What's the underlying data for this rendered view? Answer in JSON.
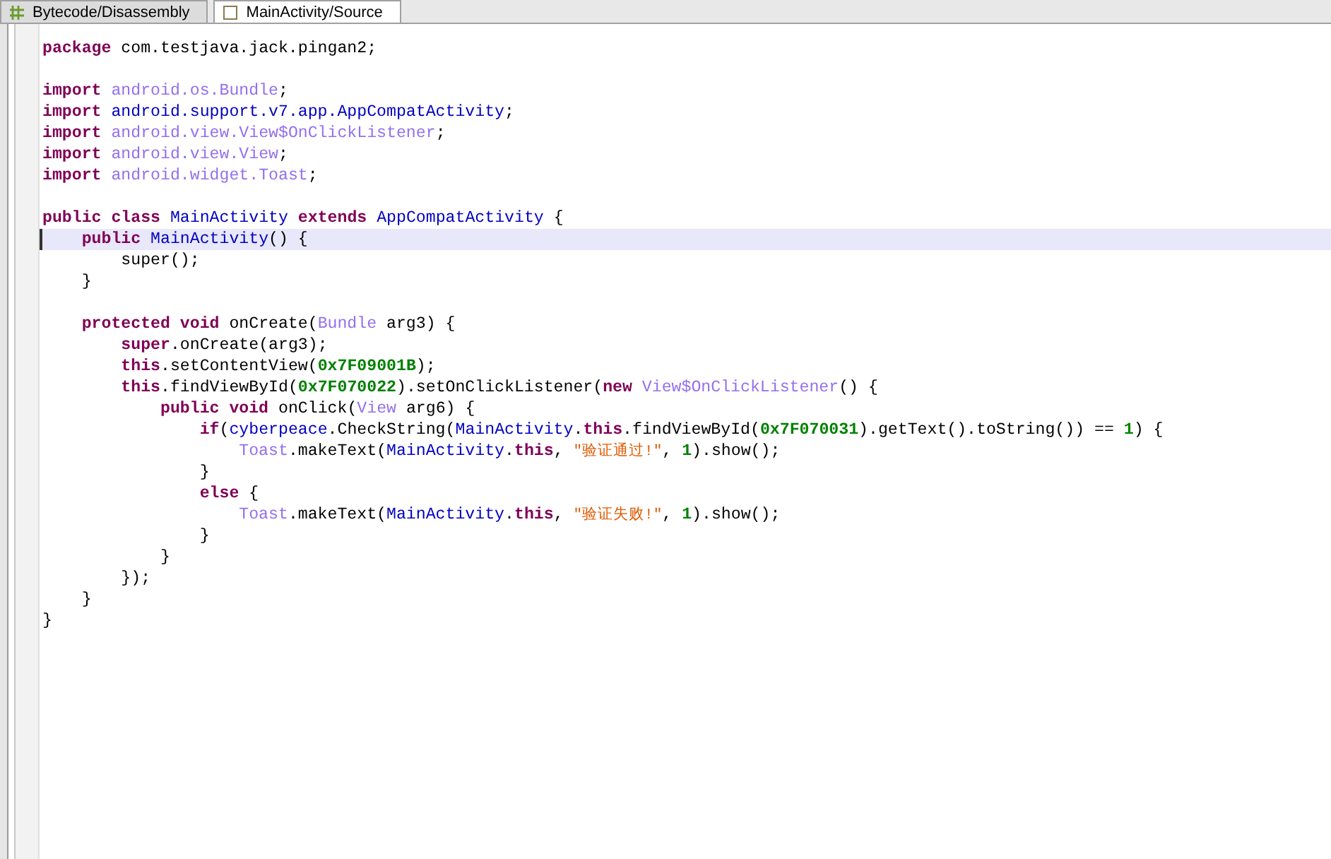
{
  "tabs": [
    {
      "label": "Bytecode/Disassembly",
      "selected": false,
      "kind": "bytecode"
    },
    {
      "label": "MainActivity/Source",
      "selected": true,
      "kind": "source"
    }
  ],
  "lines": [
    {
      "kind": "code",
      "selected": false,
      "tokens": [
        {
          "kind": "kw",
          "text": "package"
        },
        {
          "kind": "plain",
          "text": " com.testjava.jack.pingan2;"
        }
      ]
    },
    {
      "kind": "blank",
      "selected": false
    },
    {
      "kind": "code",
      "selected": false,
      "tokens": [
        {
          "kind": "kw",
          "text": "import"
        },
        {
          "kind": "type",
          "text": " android.os.Bundle"
        },
        {
          "kind": "plain",
          "text": ";"
        }
      ]
    },
    {
      "kind": "code",
      "selected": false,
      "tokens": [
        {
          "kind": "kw",
          "text": "import"
        },
        {
          "kind": "cls",
          "text": " android.support.v7.app.AppCompatActivity"
        },
        {
          "kind": "plain",
          "text": ";"
        }
      ]
    },
    {
      "kind": "code",
      "selected": false,
      "tokens": [
        {
          "kind": "kw",
          "text": "import"
        },
        {
          "kind": "type",
          "text": " android.view.View$OnClickListener"
        },
        {
          "kind": "plain",
          "text": ";"
        }
      ]
    },
    {
      "kind": "code",
      "selected": false,
      "tokens": [
        {
          "kind": "kw",
          "text": "import"
        },
        {
          "kind": "type",
          "text": " android.view.View"
        },
        {
          "kind": "plain",
          "text": ";"
        }
      ]
    },
    {
      "kind": "code",
      "selected": false,
      "tokens": [
        {
          "kind": "kw",
          "text": "import"
        },
        {
          "kind": "type",
          "text": " android.widget.Toast"
        },
        {
          "kind": "plain",
          "text": ";"
        }
      ]
    },
    {
      "kind": "blank",
      "selected": false
    },
    {
      "kind": "code",
      "selected": false,
      "tokens": [
        {
          "kind": "kw",
          "text": "public class"
        },
        {
          "kind": "cls",
          "text": " MainActivity"
        },
        {
          "kind": "kw",
          "text": " extends"
        },
        {
          "kind": "cls",
          "text": " AppCompatActivity"
        },
        {
          "kind": "plain",
          "text": " {"
        }
      ]
    },
    {
      "kind": "code",
      "selected": true,
      "tokens": [
        {
          "kind": "kw",
          "text": "    public"
        },
        {
          "kind": "cls",
          "text": " MainActivity"
        },
        {
          "kind": "plain",
          "text": "() {"
        }
      ]
    },
    {
      "kind": "code",
      "selected": false,
      "tokens": [
        {
          "kind": "plain",
          "text": "        super();"
        }
      ]
    },
    {
      "kind": "code",
      "selected": false,
      "tokens": [
        {
          "kind": "plain",
          "text": "    }"
        }
      ]
    },
    {
      "kind": "blank",
      "selected": false
    },
    {
      "kind": "code",
      "selected": false,
      "tokens": [
        {
          "kind": "kw",
          "text": "    protected void"
        },
        {
          "kind": "plain",
          "text": " onCreate("
        },
        {
          "kind": "type",
          "text": "Bundle"
        },
        {
          "kind": "plain",
          "text": " arg3) {"
        }
      ]
    },
    {
      "kind": "code",
      "selected": false,
      "tokens": [
        {
          "kind": "kw",
          "text": "        super"
        },
        {
          "kind": "plain",
          "text": ".onCreate(arg3);"
        }
      ]
    },
    {
      "kind": "code",
      "selected": false,
      "tokens": [
        {
          "kind": "kw",
          "text": "        this"
        },
        {
          "kind": "plain",
          "text": ".setContentView("
        },
        {
          "kind": "num",
          "text": "0x7F09001B"
        },
        {
          "kind": "plain",
          "text": ");"
        }
      ]
    },
    {
      "kind": "code",
      "selected": false,
      "tokens": [
        {
          "kind": "kw",
          "text": "        this"
        },
        {
          "kind": "plain",
          "text": ".findViewById("
        },
        {
          "kind": "num",
          "text": "0x7F070022"
        },
        {
          "kind": "plain",
          "text": ").setOnClickListener("
        },
        {
          "kind": "kw",
          "text": "new"
        },
        {
          "kind": "type",
          "text": " View$OnClickListener"
        },
        {
          "kind": "plain",
          "text": "() {"
        }
      ]
    },
    {
      "kind": "code",
      "selected": false,
      "tokens": [
        {
          "kind": "kw",
          "text": "            public void"
        },
        {
          "kind": "plain",
          "text": " onClick("
        },
        {
          "kind": "type",
          "text": "View"
        },
        {
          "kind": "plain",
          "text": " arg6) {"
        }
      ]
    },
    {
      "kind": "code",
      "selected": false,
      "tokens": [
        {
          "kind": "kw",
          "text": "                if"
        },
        {
          "kind": "plain",
          "text": "("
        },
        {
          "kind": "cls",
          "text": "cyberpeace"
        },
        {
          "kind": "plain",
          "text": ".CheckString("
        },
        {
          "kind": "cls",
          "text": "MainActivity"
        },
        {
          "kind": "plain",
          "text": "."
        },
        {
          "kind": "kw",
          "text": "this"
        },
        {
          "kind": "plain",
          "text": ".findViewById("
        },
        {
          "kind": "num",
          "text": "0x7F070031"
        },
        {
          "kind": "plain",
          "text": ").getText().toString()) == "
        },
        {
          "kind": "num",
          "text": "1"
        },
        {
          "kind": "plain",
          "text": ") {"
        }
      ]
    },
    {
      "kind": "code",
      "selected": false,
      "tokens": [
        {
          "kind": "type",
          "text": "                    Toast"
        },
        {
          "kind": "plain",
          "text": ".makeText("
        },
        {
          "kind": "cls",
          "text": "MainActivity"
        },
        {
          "kind": "plain",
          "text": "."
        },
        {
          "kind": "kw",
          "text": "this"
        },
        {
          "kind": "plain",
          "text": ", "
        },
        {
          "kind": "str",
          "text": "\"验证通过!\""
        },
        {
          "kind": "plain",
          "text": ", "
        },
        {
          "kind": "num",
          "text": "1"
        },
        {
          "kind": "plain",
          "text": ").show();"
        }
      ]
    },
    {
      "kind": "code",
      "selected": false,
      "tokens": [
        {
          "kind": "plain",
          "text": "                }"
        }
      ]
    },
    {
      "kind": "code",
      "selected": false,
      "tokens": [
        {
          "kind": "kw",
          "text": "                else"
        },
        {
          "kind": "plain",
          "text": " {"
        }
      ]
    },
    {
      "kind": "code",
      "selected": false,
      "tokens": [
        {
          "kind": "type",
          "text": "                    Toast"
        },
        {
          "kind": "plain",
          "text": ".makeText("
        },
        {
          "kind": "cls",
          "text": "MainActivity"
        },
        {
          "kind": "plain",
          "text": "."
        },
        {
          "kind": "kw",
          "text": "this"
        },
        {
          "kind": "plain",
          "text": ", "
        },
        {
          "kind": "str",
          "text": "\"验证失败!\""
        },
        {
          "kind": "plain",
          "text": ", "
        },
        {
          "kind": "num",
          "text": "1"
        },
        {
          "kind": "plain",
          "text": ").show();"
        }
      ]
    },
    {
      "kind": "code",
      "selected": false,
      "tokens": [
        {
          "kind": "plain",
          "text": "                }"
        }
      ]
    },
    {
      "kind": "code",
      "selected": false,
      "tokens": [
        {
          "kind": "plain",
          "text": "            }"
        }
      ]
    },
    {
      "kind": "code",
      "selected": false,
      "tokens": [
        {
          "kind": "plain",
          "text": "        });"
        }
      ]
    },
    {
      "kind": "code",
      "selected": false,
      "tokens": [
        {
          "kind": "plain",
          "text": "    }"
        }
      ]
    },
    {
      "kind": "code",
      "selected": false,
      "tokens": [
        {
          "kind": "plain",
          "text": "}"
        }
      ]
    }
  ]
}
